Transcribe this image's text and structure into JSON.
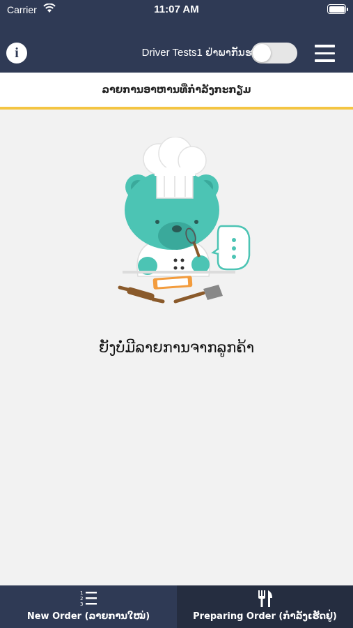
{
  "status_bar": {
    "carrier": "Carrier",
    "time": "11:07 AM"
  },
  "header": {
    "info_icon": "info-icon",
    "driver_name": "Driver Tests1 ຢ່າພາກັນຮ",
    "availability_toggle": {
      "on": false
    },
    "menu_icon": "hamburger-menu-icon"
  },
  "subheader": {
    "title": "ລາຍການອາຫານທີ່ກຳລັງກະກຽມ"
  },
  "empty_state": {
    "illustration": "chef-bear-illustration",
    "message": "ຍັງບໍ່ມີລາຍການຈາກລູກຄ້າ"
  },
  "tabs": [
    {
      "label": "New Order (ລາຍການໃໝ່)",
      "icon": "numbered-list-icon",
      "selected": false
    },
    {
      "label": "Preparing Order (ກຳລັງເຮັດຢູ່)",
      "icon": "fork-knife-icon",
      "selected": true
    }
  ],
  "colors": {
    "header_bg": "#2f3a55",
    "accent": "#f4c542",
    "bear": "#4cc4b4"
  }
}
